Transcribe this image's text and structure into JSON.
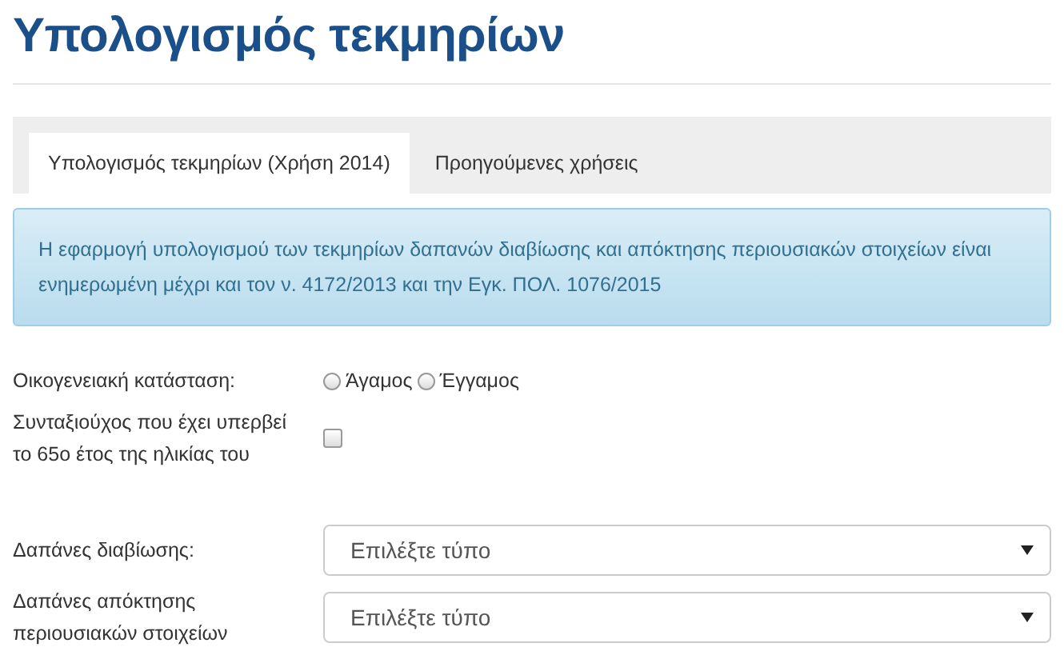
{
  "title": "Υπολογισμός τεκμηρίων",
  "tabs": [
    {
      "label": "Υπολογισμός τεκμηρίων (Χρήση 2014)",
      "selected": true
    },
    {
      "label": "Προηγούμενες χρήσεις",
      "selected": false
    }
  ],
  "info": "Η εφαρμογή υπολογισμού των τεκμηρίων δαπανών διαβίωσης και απόκτησης περιουσιακών στοιχείων είναι ενημερωμένη μέχρι και τον ν. 4172/2013 και την Εγκ. ΠΟΛ. 1076/2015",
  "fields": [
    {
      "kind": "radio",
      "label": "Οικογενειακή κατάσταση:",
      "options": [
        {
          "label": "Άγαμος",
          "selected": false
        },
        {
          "label": "Έγγαμος",
          "selected": false
        }
      ]
    },
    {
      "kind": "checkbox",
      "label": "Συνταξιούχος που έχει υπερβεί το 65ο έτος της ηλικίας του",
      "checked": false
    },
    {
      "kind": "select",
      "label": "Δαπάνες διαβίωσης:",
      "value": "Επιλέξτε τύπο"
    },
    {
      "kind": "select",
      "label": "Δαπάνες απόκτησης περιουσιακών στοιχείων",
      "value": "Επιλέξτε τύπο"
    }
  ]
}
